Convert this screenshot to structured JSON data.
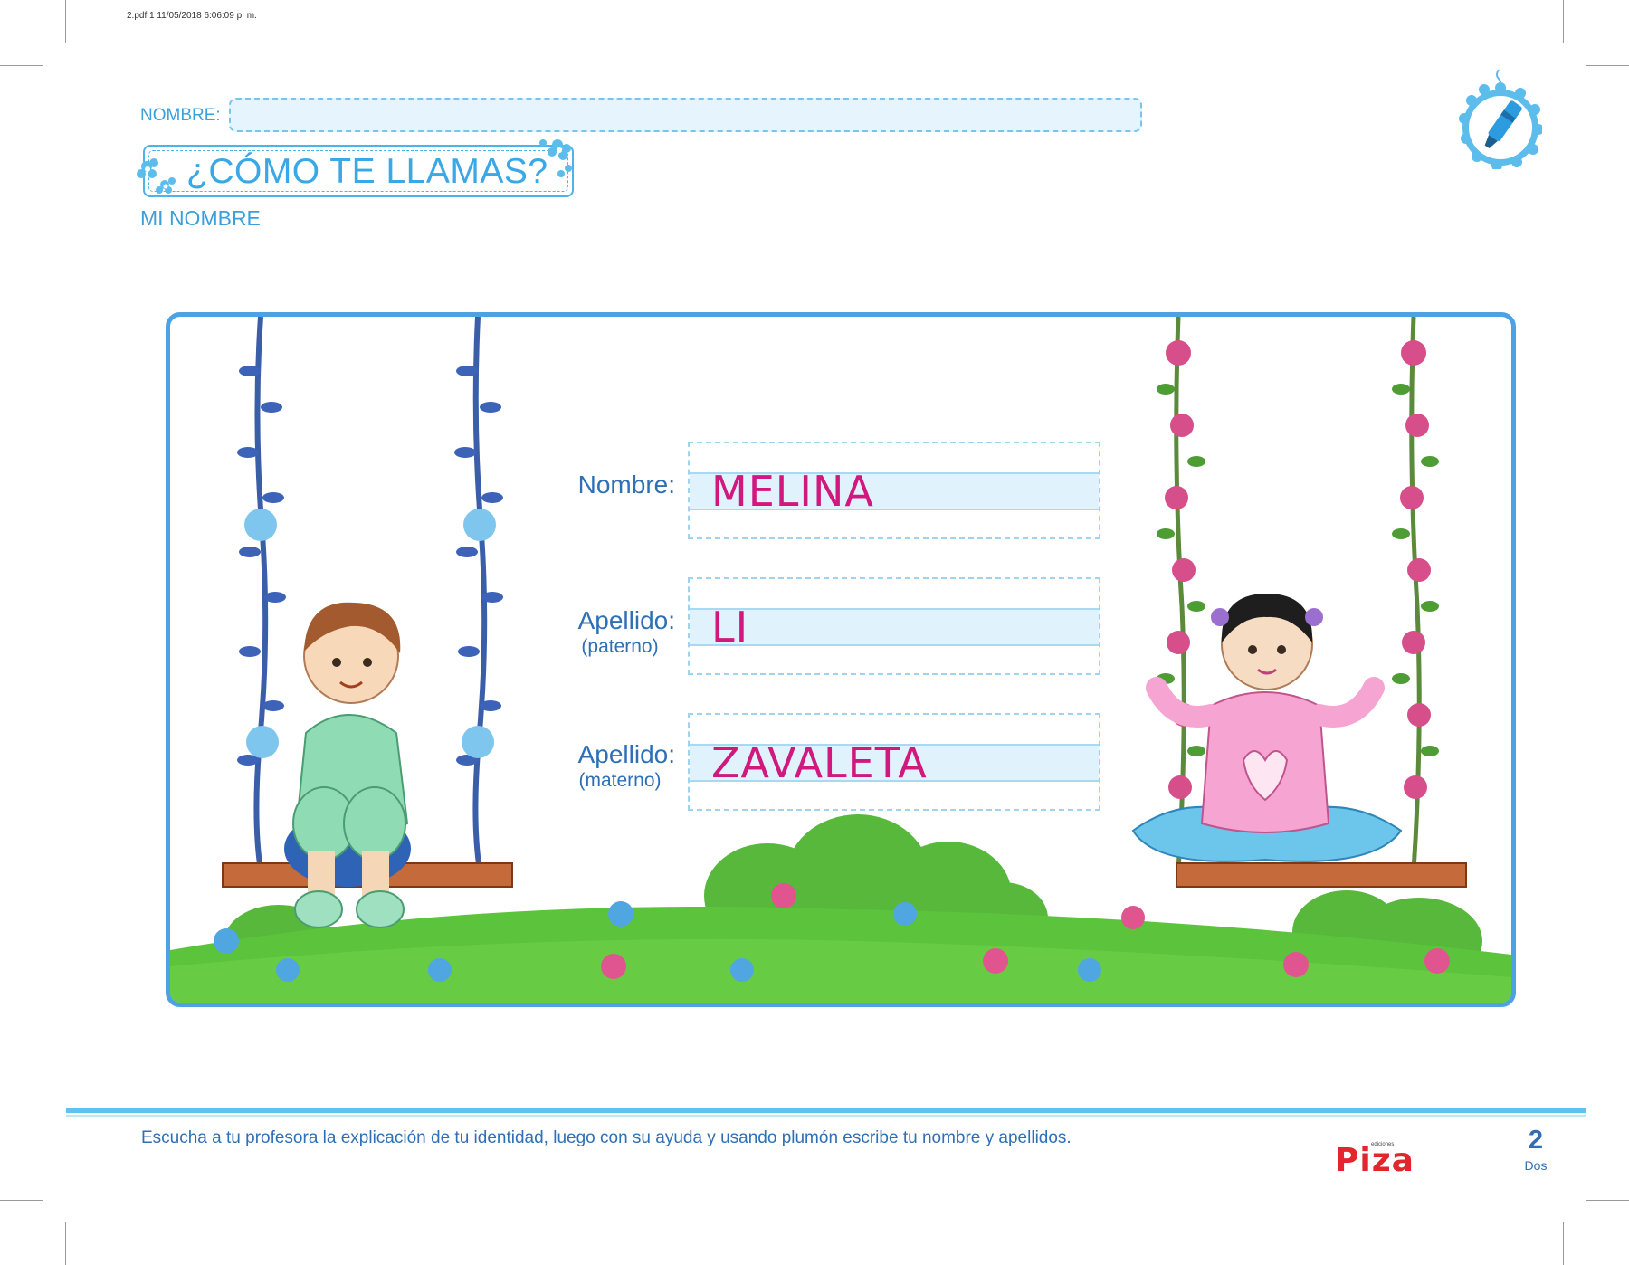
{
  "print_info": "2.pdf   1   11/05/2018   6:06:09 p. m.",
  "header": {
    "name_label": "NOMBRE:",
    "title": "¿CÓMO TE LLAMAS?",
    "subtitle": "MI NOMBRE"
  },
  "form": {
    "fields": [
      {
        "label": "Nombre:",
        "sublabel": "",
        "value": "MELINA"
      },
      {
        "label": "Apellido:",
        "sublabel": "(paterno)",
        "value": "LI"
      },
      {
        "label": "Apellido:",
        "sublabel": "(materno)",
        "value": "ZAVALETA"
      }
    ]
  },
  "footer": {
    "instruction": "Escucha a tu profesora la explicación de tu identidad, luego con su ayuda y usando plumón escribe tu nombre y apellidos.",
    "logo_small": "ediciones",
    "logo": "Piza",
    "page_number": "2",
    "page_word": "Dos"
  },
  "colors": {
    "accent_blue": "#3aa8e6",
    "frame_blue": "#4da2e3",
    "label_blue": "#2e6fb5",
    "value_magenta": "#d0187e",
    "grass_green": "#5cc43c",
    "logo_red": "#e3262e"
  },
  "icons": [
    "marker-badge-icon",
    "blue-flower-icon",
    "pink-flower-icon"
  ]
}
